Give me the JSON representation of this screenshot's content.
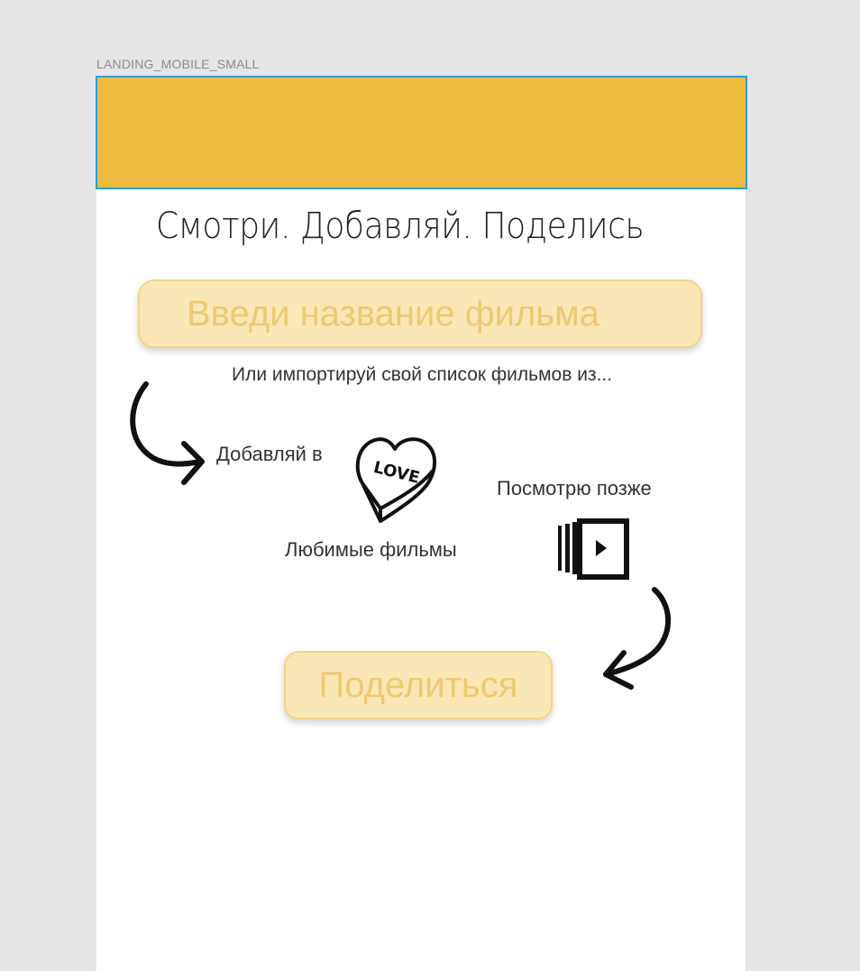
{
  "frame": {
    "label": "LANDING_MOBILE_SMALL"
  },
  "header": {
    "color": "#ecbb3d",
    "selection_color": "#2a9ee6"
  },
  "hero": {
    "tagline": "Смотри. Добавляй. Поделись"
  },
  "search": {
    "placeholder": "Введи название фильма",
    "value": ""
  },
  "import": {
    "hint": "Или импортируй свой список фильмов из..."
  },
  "lists": {
    "add_to_label": "Добавляй в",
    "favorites": {
      "label": "Любимые фильмы",
      "icon": "love-heart-icon",
      "icon_text": "LOVE"
    },
    "watch_later": {
      "label": "Посмотрю позже",
      "icon": "watch-later-icon"
    }
  },
  "share": {
    "label": "Поделиться"
  },
  "colors": {
    "accent": "#ecbb3d",
    "button_fill": "#fae7b6",
    "button_text": "#ecc973",
    "background": "#e5e5e5",
    "artboard": "#ffffff"
  }
}
